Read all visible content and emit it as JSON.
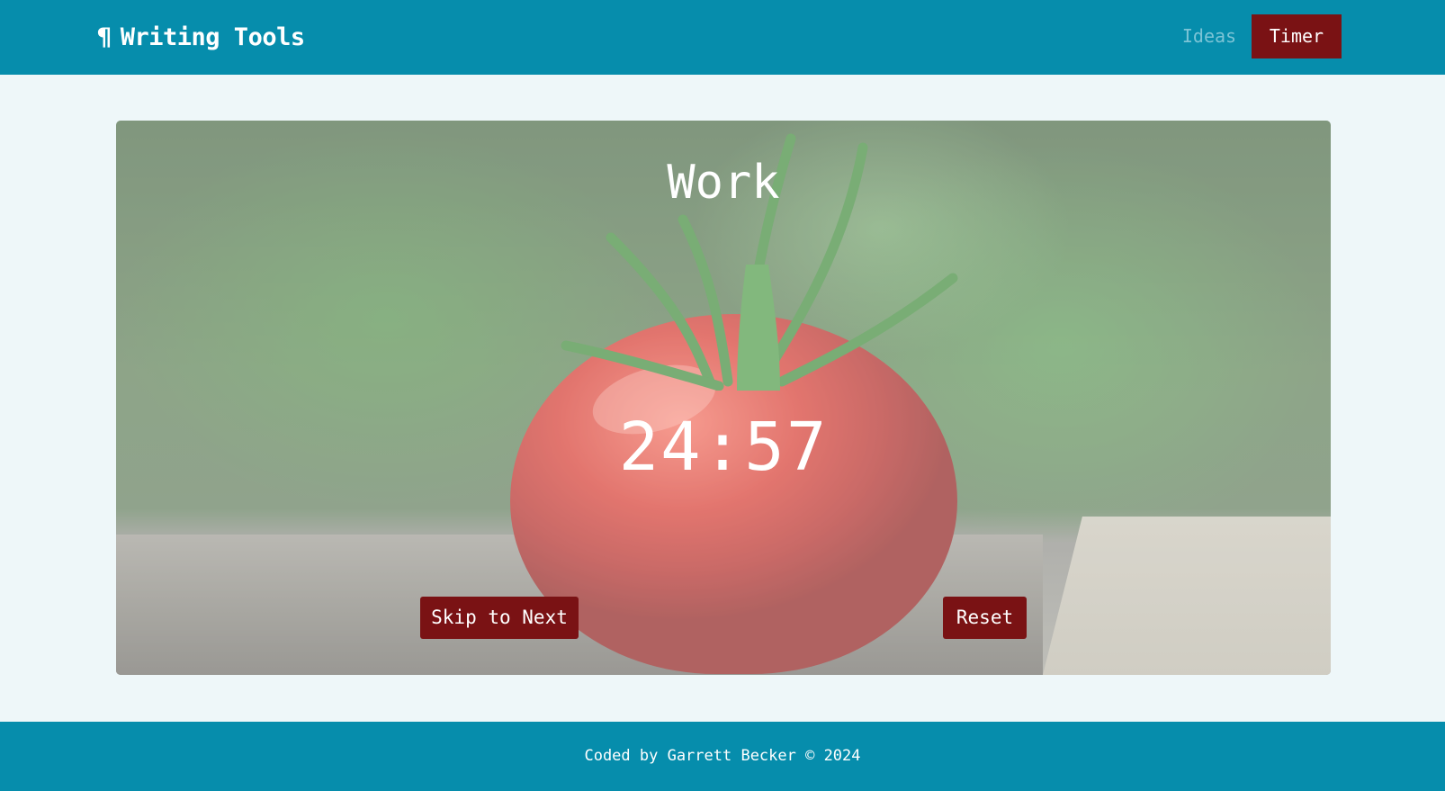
{
  "header": {
    "brand_icon": "¶",
    "brand_title": "Writing Tools",
    "nav": {
      "ideas_label": "Ideas",
      "timer_label": "Timer"
    }
  },
  "timer": {
    "phase": "Work",
    "time_display": "24:57",
    "background_image": "tomato-photo",
    "skip_label": "Skip to Next",
    "reset_label": "Reset"
  },
  "footer": {
    "credit": "Coded by Garrett Becker © 2024"
  },
  "colors": {
    "primary": "#068dac",
    "accent": "#7a1214",
    "page_bg": "#eef7f9",
    "nav_inactive_text": "#7cc4d6"
  }
}
